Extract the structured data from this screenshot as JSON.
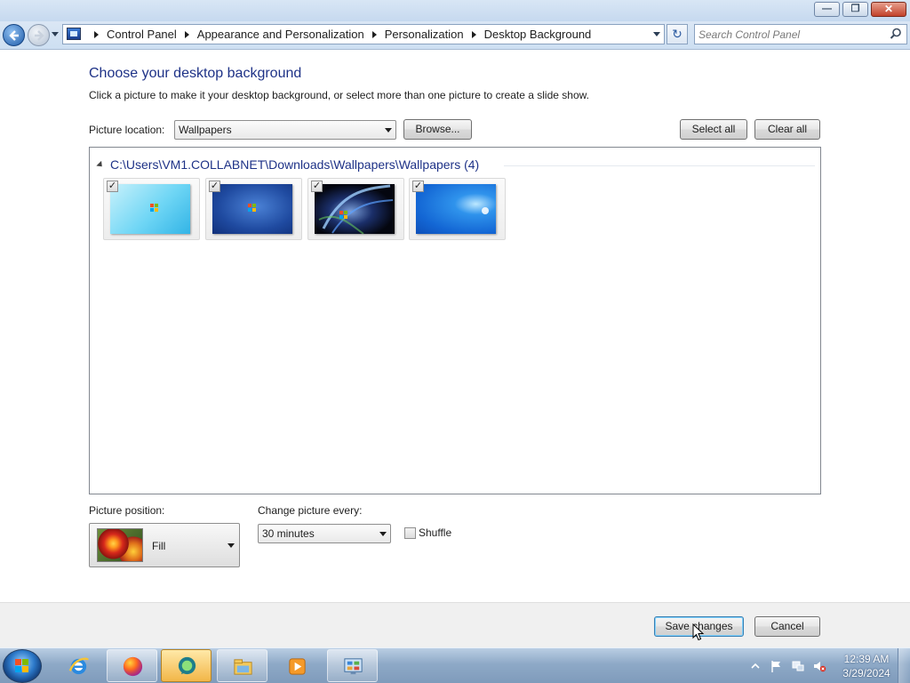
{
  "window": {
    "controls": {
      "minimize_icon": "minimize-icon",
      "maximize_icon": "restore-icon",
      "close_icon": "close-icon"
    }
  },
  "address_bar": {
    "breadcrumbs": [
      "Control Panel",
      "Appearance and Personalization",
      "Personalization",
      "Desktop Background"
    ],
    "search_placeholder": "Search Control Panel"
  },
  "main": {
    "heading": "Choose your desktop background",
    "instructions": "Click a picture to make it your desktop background, or select more than one picture to create a slide show.",
    "picture_location": {
      "label": "Picture location:",
      "value": "Wallpapers"
    },
    "buttons": {
      "browse": "Browse...",
      "select_all": "Select all",
      "clear_all": "Clear all"
    },
    "gallery": {
      "group_title": "C:\\Users\\VM1.COLLABNET\\Downloads\\Wallpapers\\Wallpapers (4)",
      "thumbnails": [
        {
          "checked": true,
          "check_glyph": "✓"
        },
        {
          "checked": true,
          "check_glyph": "✓"
        },
        {
          "checked": true,
          "check_glyph": "✓"
        },
        {
          "checked": true,
          "check_glyph": "✓"
        }
      ]
    },
    "picture_position": {
      "label": "Picture position:",
      "value": "Fill"
    },
    "change_every": {
      "label": "Change picture every:",
      "value": "30 minutes"
    },
    "shuffle": {
      "label": "Shuffle",
      "checked": false
    }
  },
  "footer": {
    "save": "Save changes",
    "cancel": "Cancel"
  },
  "taskbar": {
    "apps": [
      "internet-explorer-icon",
      "firefox-icon",
      "app-icon",
      "windows-explorer-icon",
      "media-player-icon",
      "control-panel-icon"
    ],
    "clock": {
      "time": "12:39 AM",
      "date": "3/29/2024"
    }
  },
  "colors": {
    "heading": "#1e3287",
    "taskbar": "#8ea9c7",
    "accent": "#3c7fb1"
  }
}
